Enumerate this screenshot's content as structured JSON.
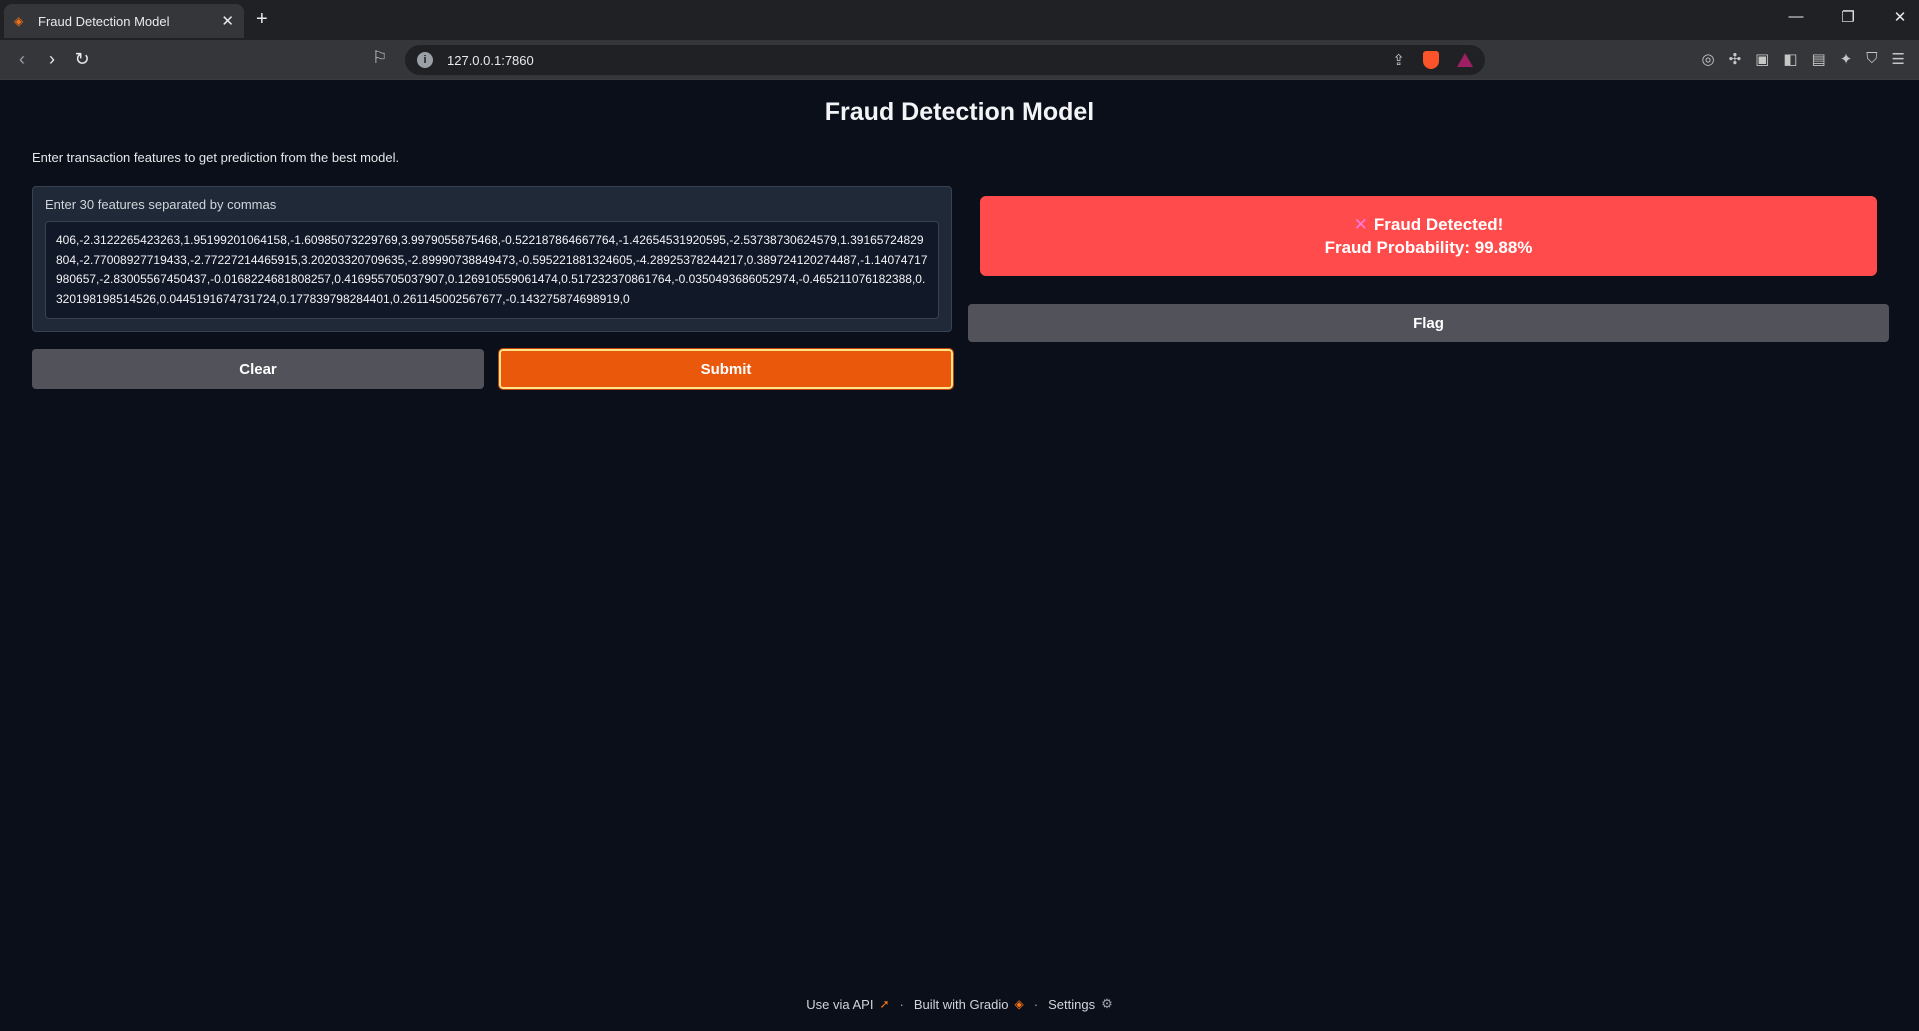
{
  "browser": {
    "tab_title": "Fraud Detection Model",
    "url": "127.0.0.1:7860"
  },
  "app": {
    "title": "Fraud Detection Model",
    "description": "Enter transaction features to get prediction from the best model.",
    "input_label": "Enter 30 features separated by commas",
    "features_value": "406,-2.3122265423263,1.95199201064158,-1.60985073229769,3.9979055875468,-0.522187864667764,-1.42654531920595,-2.53738730624579,1.39165724829804,-2.77008927719433,-2.77227214465915,3.20203320709635,-2.89990738849473,-0.595221881324605,-4.28925378244217,0.389724120274487,-1.14074717980657,-2.83005567450437,-0.0168224681808257,0.416955705037907,0.126910559061474,0.517232370861764,-0.0350493686052974,-0.465211076182388,0.320198198514526,0.0445191674731724,0.177839798284401,0.261145002567677,-0.143275874698919,0",
    "clear_label": "Clear",
    "submit_label": "Submit",
    "result_title": "Fraud Detected!",
    "result_probability": "Fraud Probability: 99.88%",
    "flag_label": "Flag"
  },
  "footer": {
    "api_label": "Use via API",
    "built_label": "Built with Gradio",
    "settings_label": "Settings",
    "separator": "·"
  },
  "colors": {
    "result_bg": "#ff4b4b",
    "submit_bg": "#ea580c",
    "secondary_btn_bg": "#52525b",
    "page_bg": "#0b0f19"
  }
}
